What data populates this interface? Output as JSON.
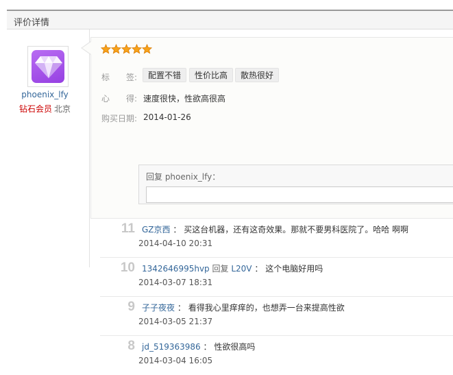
{
  "panel": {
    "title": "评价详情"
  },
  "user": {
    "name": "phoenix_lfy",
    "level": "钻石会员",
    "city": "北京"
  },
  "review": {
    "stars": 5,
    "tags_label": "标　　签:",
    "tags": [
      "配置不错",
      "性价比高",
      "散热很好"
    ],
    "comment_label": "心　　得:",
    "comment": "速度很快，性欲高很高",
    "date_label": "购买日期:",
    "date": "2014-01-26"
  },
  "reply": {
    "label": "回复 phoenix_lfy：",
    "placeholder": ""
  },
  "comments": [
    {
      "num": "11",
      "user": "GZ京西",
      "reply_word": "",
      "reply_to": "",
      "sep": "：",
      "text": "买这台机器，还有这奇效果。那就不要男科医院了。哈哈 啊啊",
      "date": "2014-04-10 20:31"
    },
    {
      "num": "10",
      "user": "1342646995hvp",
      "reply_word": "回复",
      "reply_to": "L20V",
      "sep": "：",
      "text": "这个电脑好用吗",
      "date": "2014-03-07 18:31"
    },
    {
      "num": "9",
      "user": "子子夜夜",
      "reply_word": "",
      "reply_to": "",
      "sep": "：",
      "text": "看得我心里痒痒的，也想弄一台来提高性欲",
      "date": "2014-03-05 21:37"
    },
    {
      "num": "8",
      "user": "jd_519363986",
      "reply_word": "",
      "reply_to": "",
      "sep": "：",
      "text": "性欲很高吗",
      "date": "2014-03-04 16:05"
    }
  ],
  "colors": {
    "accent_link": "#336699",
    "level": "#cc0000",
    "star": "#f7a21b",
    "avatar": "#a14ee7"
  }
}
